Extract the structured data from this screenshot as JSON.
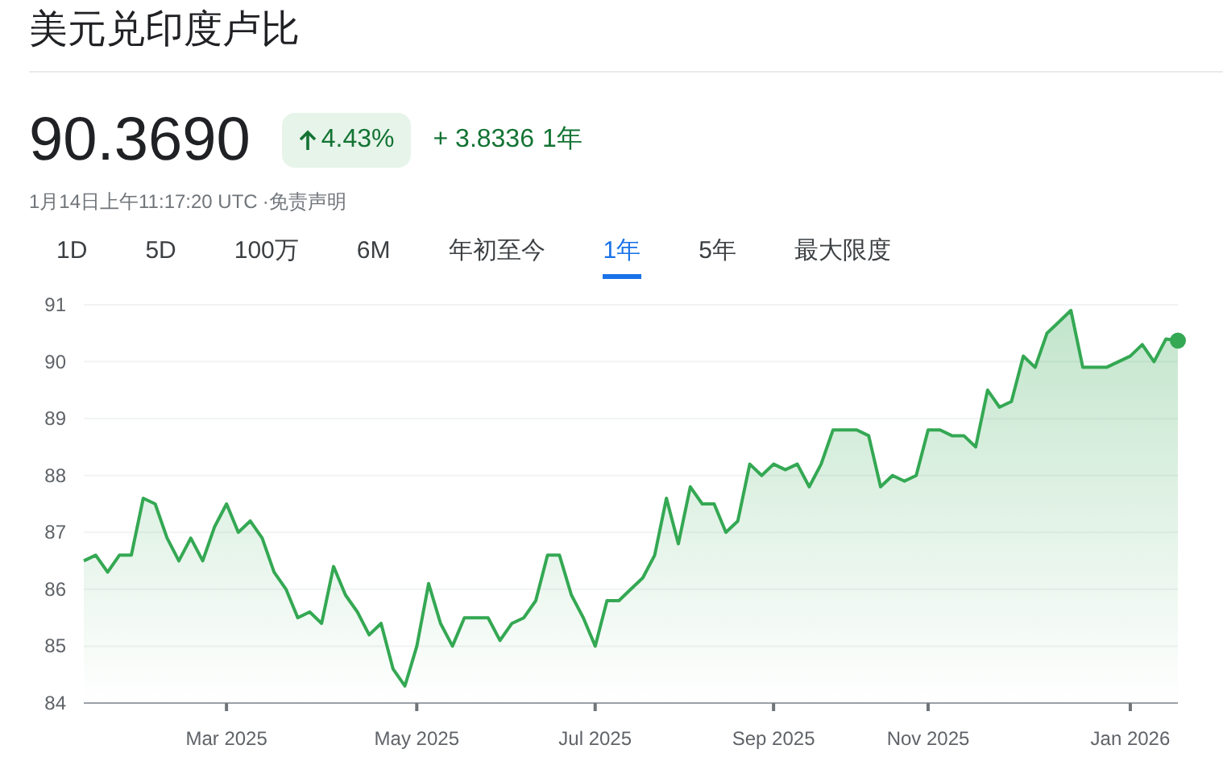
{
  "title": "美元兑印度卢比",
  "price": "90.3690",
  "change": {
    "percent": "4.43%",
    "absolute": "+ 3.8336",
    "period": "1年",
    "rising": true
  },
  "timestamp": "1月14日上午11:17:20 UTC",
  "disclaimer": "·免责声明",
  "tabs": [
    {
      "label": "1D",
      "selected": false
    },
    {
      "label": "5D",
      "selected": false
    },
    {
      "label": "100万",
      "selected": false
    },
    {
      "label": "6M",
      "selected": false
    },
    {
      "label": "年初至今",
      "selected": false
    },
    {
      "label": "1年",
      "selected": true
    },
    {
      "label": "5年",
      "selected": false
    },
    {
      "label": "最大限度",
      "selected": false
    }
  ],
  "chart_data": {
    "type": "area",
    "grid": true,
    "ylim": [
      84,
      91
    ],
    "categories": [
      null,
      null,
      null,
      null,
      null,
      null,
      null,
      null,
      null,
      null,
      null,
      null,
      "Mar 2025",
      null,
      null,
      null,
      null,
      null,
      null,
      null,
      null,
      null,
      null,
      null,
      null,
      null,
      null,
      null,
      "May 2025",
      null,
      null,
      null,
      null,
      null,
      null,
      null,
      null,
      null,
      null,
      null,
      null,
      null,
      null,
      "Jul 2025",
      null,
      null,
      null,
      null,
      null,
      null,
      null,
      null,
      null,
      null,
      null,
      null,
      null,
      null,
      "Sep 2025",
      null,
      null,
      null,
      null,
      null,
      null,
      null,
      null,
      null,
      null,
      null,
      null,
      "Nov 2025",
      null,
      null,
      null,
      null,
      null,
      null,
      null,
      null,
      null,
      null,
      null,
      null,
      null,
      null,
      null,
      null,
      "Jan 2026",
      null,
      null,
      null,
      null
    ],
    "series": [
      {
        "color": "#34a853",
        "values": [
          86.5,
          86.6,
          86.3,
          86.6,
          86.6,
          87.6,
          87.5,
          86.9,
          86.5,
          86.9,
          86.5,
          87.1,
          87.5,
          87.0,
          87.2,
          86.9,
          86.3,
          86.0,
          85.5,
          85.6,
          85.4,
          86.4,
          85.9,
          85.6,
          85.2,
          85.4,
          84.6,
          84.3,
          85.0,
          86.1,
          85.4,
          85.0,
          85.5,
          85.5,
          85.5,
          85.1,
          85.4,
          85.5,
          85.8,
          86.6,
          86.6,
          85.9,
          85.5,
          85.0,
          85.8,
          85.8,
          86.0,
          86.2,
          86.6,
          87.6,
          86.8,
          87.8,
          87.5,
          87.5,
          87.0,
          87.2,
          88.2,
          88.0,
          88.2,
          88.1,
          88.2,
          87.8,
          88.2,
          88.8,
          88.8,
          88.8,
          88.7,
          87.8,
          88.0,
          87.9,
          88.0,
          88.8,
          88.8,
          88.7,
          88.7,
          88.5,
          89.5,
          89.2,
          89.3,
          90.1,
          89.9,
          90.5,
          90.7,
          90.9,
          89.9,
          89.9,
          89.9,
          90.0,
          90.1,
          90.3,
          90.0,
          90.4,
          90.37
        ]
      }
    ],
    "yticks": [
      84,
      85,
      86,
      87,
      88,
      89,
      90,
      91
    ]
  }
}
